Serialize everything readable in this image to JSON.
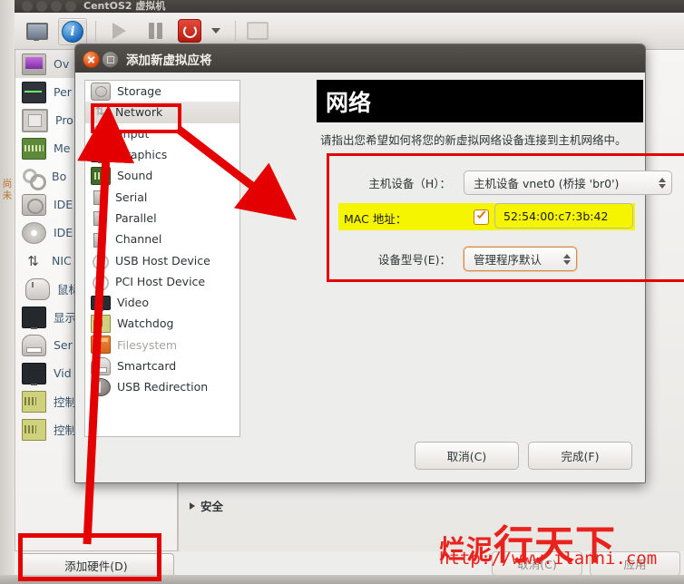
{
  "background_window": {
    "title": "CentOS2 虚拟机",
    "toolbar": {
      "buttons": [
        {
          "name": "console-view",
          "icon": "monitor-icon"
        },
        {
          "name": "details-view",
          "icon": "info-icon"
        },
        {
          "name": "run",
          "icon": "play-icon"
        },
        {
          "name": "pause",
          "icon": "pause-icon"
        },
        {
          "name": "shutdown",
          "icon": "power-icon"
        },
        {
          "name": "shutdown-menu",
          "icon": "caret-down-icon"
        },
        {
          "name": "fullscreen",
          "icon": "fullscreen-icon"
        }
      ]
    },
    "edge_text": "尚未",
    "hardware_list": [
      {
        "label": "Ov",
        "icon": "overview-icon",
        "selected": true
      },
      {
        "label": "Per",
        "icon": "performance-icon",
        "selected": false
      },
      {
        "label": "Pro",
        "icon": "processor-icon",
        "selected": false
      },
      {
        "label": "Me",
        "icon": "memory-icon",
        "selected": false
      },
      {
        "label": "Bo",
        "icon": "boot-options-icon",
        "selected": false
      },
      {
        "label": "IDE",
        "icon": "disk-icon",
        "selected": false
      },
      {
        "label": "IDE",
        "icon": "cdrom-icon",
        "selected": false
      },
      {
        "label": "NIC",
        "icon": "nic-icon",
        "selected": false
      },
      {
        "label": "鼠标",
        "icon": "mouse-icon",
        "selected": false
      },
      {
        "label": "显示",
        "icon": "display-icon",
        "selected": false
      },
      {
        "label": "Ser",
        "icon": "serial-icon",
        "selected": false
      },
      {
        "label": "Vid",
        "icon": "video-icon",
        "selected": false
      },
      {
        "label": "控制",
        "icon": "controller-icon",
        "selected": false
      },
      {
        "label": "控制",
        "icon": "controller-icon",
        "selected": false
      }
    ],
    "add_hardware_label": "添加硬件(D)",
    "section_security_label": "安全",
    "bottom_buttons": [
      {
        "label": "取消(C)",
        "name": "cancel-button"
      },
      {
        "label": "应用",
        "name": "apply-button"
      }
    ]
  },
  "dialog": {
    "title": "添加新虚拟应将",
    "window_buttons": {
      "close": "close-icon",
      "maximize": "maximize-icon"
    },
    "device_list": [
      {
        "label": "Storage",
        "icon": "storage-icon",
        "selected": false,
        "disabled": false
      },
      {
        "label": "Network",
        "icon": "network-icon",
        "selected": true,
        "disabled": false
      },
      {
        "label": "Input",
        "icon": "input-icon",
        "selected": false,
        "disabled": false
      },
      {
        "label": "Graphics",
        "icon": "graphics-icon",
        "selected": false,
        "disabled": false
      },
      {
        "label": "Sound",
        "icon": "sound-icon",
        "selected": false,
        "disabled": false
      },
      {
        "label": "Serial",
        "icon": "serial-port-icon",
        "selected": false,
        "disabled": false
      },
      {
        "label": "Parallel",
        "icon": "parallel-port-icon",
        "selected": false,
        "disabled": false
      },
      {
        "label": "Channel",
        "icon": "channel-icon",
        "selected": false,
        "disabled": false
      },
      {
        "label": "USB Host Device",
        "icon": "usb-host-device-icon",
        "selected": false,
        "disabled": false
      },
      {
        "label": "PCI Host Device",
        "icon": "pci-host-device-icon",
        "selected": false,
        "disabled": false
      },
      {
        "label": "Video",
        "icon": "video-icon",
        "selected": false,
        "disabled": false
      },
      {
        "label": "Watchdog",
        "icon": "watchdog-icon",
        "selected": false,
        "disabled": false
      },
      {
        "label": "Filesystem",
        "icon": "filesystem-icon",
        "selected": false,
        "disabled": true
      },
      {
        "label": "Smartcard",
        "icon": "smartcard-icon",
        "selected": false,
        "disabled": false
      },
      {
        "label": "USB Redirection",
        "icon": "usb-redirection-icon",
        "selected": false,
        "disabled": false
      }
    ],
    "panel": {
      "heading": "网络",
      "description": "请指出您希望如何将您的新虚拟网络设备连接到主机网络中。",
      "fields": {
        "host_device": {
          "label": "主机设备（H）：",
          "value": "主机设备 vnet0 (桥接 'br0')"
        },
        "mac_address": {
          "label": "MAC 地址：",
          "checked": true,
          "value": "52:54:00:c7:3b:42",
          "highlight_color": "#f5f500"
        },
        "device_model": {
          "label": "设备型号(E)：",
          "value": "管理程序默认"
        }
      }
    },
    "buttons": [
      {
        "label": "取消(C)",
        "name": "cancel-button"
      },
      {
        "label": "完成(F)",
        "name": "finish-button"
      }
    ]
  },
  "annotations": {
    "highlight_color": "#e40000",
    "boxes": [
      "network-list-item",
      "add-hardware-button",
      "network-fields-group"
    ],
    "arrows": [
      "add-hardware-to-network",
      "network-to-mac-field"
    ]
  },
  "watermark": {
    "text_left": "烂泥",
    "text_big": "行天下",
    "url": "http://www.ilanni.com",
    "color": "#e8221c"
  }
}
